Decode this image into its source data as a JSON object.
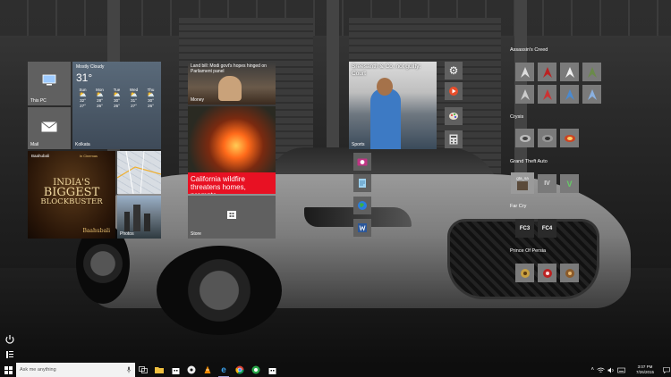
{
  "tiles": {
    "this_pc": "This PC",
    "mail": "Mail",
    "weather": {
      "condition": "Mostly Cloudy",
      "temp": "31°",
      "location": "Kolkata",
      "days": [
        {
          "day": "Sun",
          "high": "32°",
          "low": "27°"
        },
        {
          "day": "Mon",
          "high": "28°",
          "low": "26°"
        },
        {
          "day": "Tue",
          "high": "30°",
          "low": "26°"
        },
        {
          "day": "Wed",
          "high": "31°",
          "low": "27°"
        },
        {
          "day": "Thu",
          "high": "30°",
          "low": "26°"
        }
      ]
    },
    "movie": {
      "brand": "Baahubali",
      "cinemas": "In Cinemas",
      "line1": "INDIA'S",
      "line2": "BIGGEST",
      "line3": "BLOCKBUSTER",
      "logo": "Baahubali"
    },
    "maps": "",
    "photos": "Photos",
    "news_headline": "Land bill: Modi govt's hopes hinged on Parliament panel",
    "news_label": "Money",
    "fire_headline": "California wildfire threatens homes, prompts",
    "store": "Store",
    "sports_headline": "Sreesanth & Co. not guilty: Court",
    "sports_label": "Sports"
  },
  "groups": {
    "assassins": "Assassin's Creed",
    "crysis": "Crysis",
    "gta": "Grand Theft Auto",
    "gta_tile": "gta_sa",
    "farcry": "Far Cry",
    "fc3": "FC3",
    "fc4": "FC4",
    "persia": "Prince Of Persia"
  },
  "taskbar": {
    "search_placeholder": "Ask me anything",
    "time": "3:07 PM",
    "date": "7/26/2015"
  },
  "colors": {
    "tile_gray": "#606060",
    "news_red": "#e81123",
    "taskbar": "#0e0e0e"
  }
}
